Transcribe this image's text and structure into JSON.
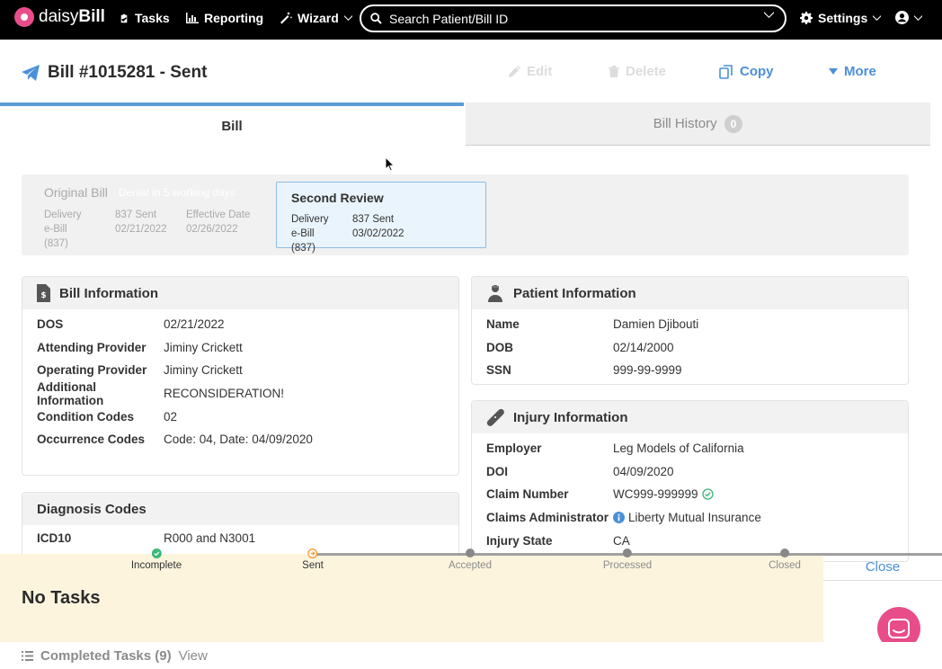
{
  "nav": {
    "brand_part1": "daisy",
    "brand_part2": "Bill",
    "tasks": "Tasks",
    "reporting": "Reporting",
    "wizard": "Wizard",
    "search_placeholder": "Search Patient/Bill ID",
    "settings": "Settings"
  },
  "header": {
    "title": "Bill #1015281 - Sent",
    "edit": "Edit",
    "delete": "Delete",
    "copy": "Copy",
    "more": "More"
  },
  "tabs": {
    "bill": "Bill",
    "history": "Bill History",
    "history_count": "0"
  },
  "timeline": {
    "original": {
      "title": "Original Bill",
      "note": "Denial in 5 working days",
      "delivery_label": "Delivery",
      "delivery_value": "e-Bill (837)",
      "sent_label": "837 Sent",
      "sent_value": "02/21/2022",
      "effective_label": "Effective Date",
      "effective_value": "02/26/2022"
    },
    "second": {
      "title": "Second Review",
      "delivery_label": "Delivery",
      "delivery_value": "e-Bill (837)",
      "sent_label": "837 Sent",
      "sent_value": "03/02/2022"
    }
  },
  "bill_info": {
    "title": "Bill Information",
    "rows": [
      {
        "label": "DOS",
        "value": "02/21/2022"
      },
      {
        "label": "Attending Provider",
        "value": "Jiminy Crickett"
      },
      {
        "label": "Operating Provider",
        "value": "Jiminy Crickett"
      },
      {
        "label": "Additional Information",
        "value": "RECONSIDERATION!"
      },
      {
        "label": "Condition Codes",
        "value": "02"
      },
      {
        "label": "Occurrence Codes",
        "value": "Code: 04, Date: 04/09/2020"
      }
    ]
  },
  "diagnosis": {
    "title": "Diagnosis Codes",
    "label": "ICD10",
    "value": "R000 and N3001"
  },
  "patient_info": {
    "title": "Patient Information",
    "rows": [
      {
        "label": "Name",
        "value": "Damien Djibouti"
      },
      {
        "label": "DOB",
        "value": "02/14/2000"
      },
      {
        "label": "SSN",
        "value": "999-99-9999"
      }
    ]
  },
  "injury_info": {
    "title": "Injury Information",
    "employer_label": "Employer",
    "employer_value": "Leg Models of California",
    "doi_label": "DOI",
    "doi_value": "04/09/2020",
    "claim_label": "Claim Number",
    "claim_value": "WC999-999999",
    "admin_label": "Claims Administrator",
    "admin_value": "Liberty Mutual Insurance",
    "state_label": "Injury State",
    "state_value": "CA"
  },
  "tasks_panel": {
    "no_tasks": "No Tasks",
    "close": "Close",
    "completed": "Completed Tasks (9)",
    "view": "View",
    "steps": [
      "Incomplete",
      "Sent",
      "Accepted",
      "Processed",
      "Closed"
    ]
  },
  "colors": {
    "brand": "#e84d8a",
    "accent": "#4a90d9",
    "nav_bg": "#000000"
  }
}
